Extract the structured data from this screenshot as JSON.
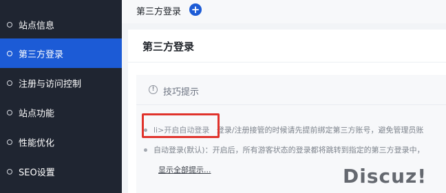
{
  "sidebar": {
    "items": [
      {
        "label": "站点信息"
      },
      {
        "label": "第三方登录",
        "active": true
      },
      {
        "label": "注册与访问控制"
      },
      {
        "label": "站点功能"
      },
      {
        "label": "性能优化"
      },
      {
        "label": "SEO设置"
      }
    ]
  },
  "topbar": {
    "breadcrumb": "第三方登录",
    "add_icon": "plus-circle-icon"
  },
  "panel": {
    "title": "第三方登录",
    "tips": {
      "icon": "exclamation-circle-icon",
      "title": "技巧提示",
      "rows": [
        {
          "highlight": "li>开启自动登录",
          "text": "登录/注册接管的时候请先提前绑定第三方账号，避免管理员账"
        },
        {
          "highlight": "",
          "text": "自动登录(默认)：开启后，所有游客状态的登录都将跳转到指定的第三方登录中，"
        }
      ],
      "show_all": "显示全部提示..."
    }
  },
  "watermark": "Discuz!",
  "colors": {
    "sidebar_bg": "#1f2531",
    "active_bg": "#1c5bd6",
    "highlight_border": "#e0322b"
  }
}
